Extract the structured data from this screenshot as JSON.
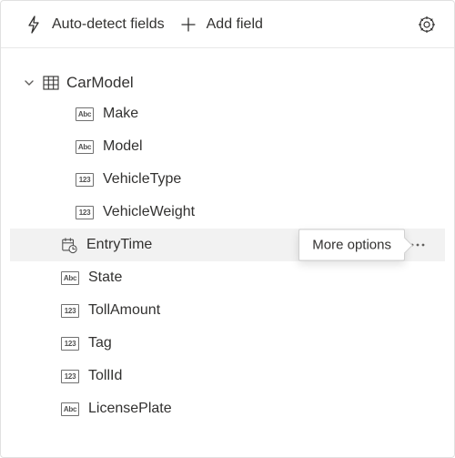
{
  "toolbar": {
    "autodetect_label": "Auto-detect fields",
    "addfield_label": "Add field"
  },
  "tree": {
    "root_label": "CarModel",
    "fields": [
      {
        "name": "Make",
        "type": "Abc",
        "indent": true,
        "selected": false
      },
      {
        "name": "Model",
        "type": "Abc",
        "indent": true,
        "selected": false
      },
      {
        "name": "VehicleType",
        "type": "123",
        "indent": true,
        "selected": false
      },
      {
        "name": "VehicleWeight",
        "type": "123",
        "indent": true,
        "selected": false
      },
      {
        "name": "EntryTime",
        "type": "datetime",
        "indent": false,
        "selected": true
      },
      {
        "name": "State",
        "type": "Abc",
        "indent": false,
        "selected": false
      },
      {
        "name": "TollAmount",
        "type": "123",
        "indent": false,
        "selected": false
      },
      {
        "name": "Tag",
        "type": "123",
        "indent": false,
        "selected": false
      },
      {
        "name": "TollId",
        "type": "123",
        "indent": false,
        "selected": false
      },
      {
        "name": "LicensePlate",
        "type": "Abc",
        "indent": false,
        "selected": false
      }
    ]
  },
  "tooltip": {
    "more_options": "More options"
  }
}
